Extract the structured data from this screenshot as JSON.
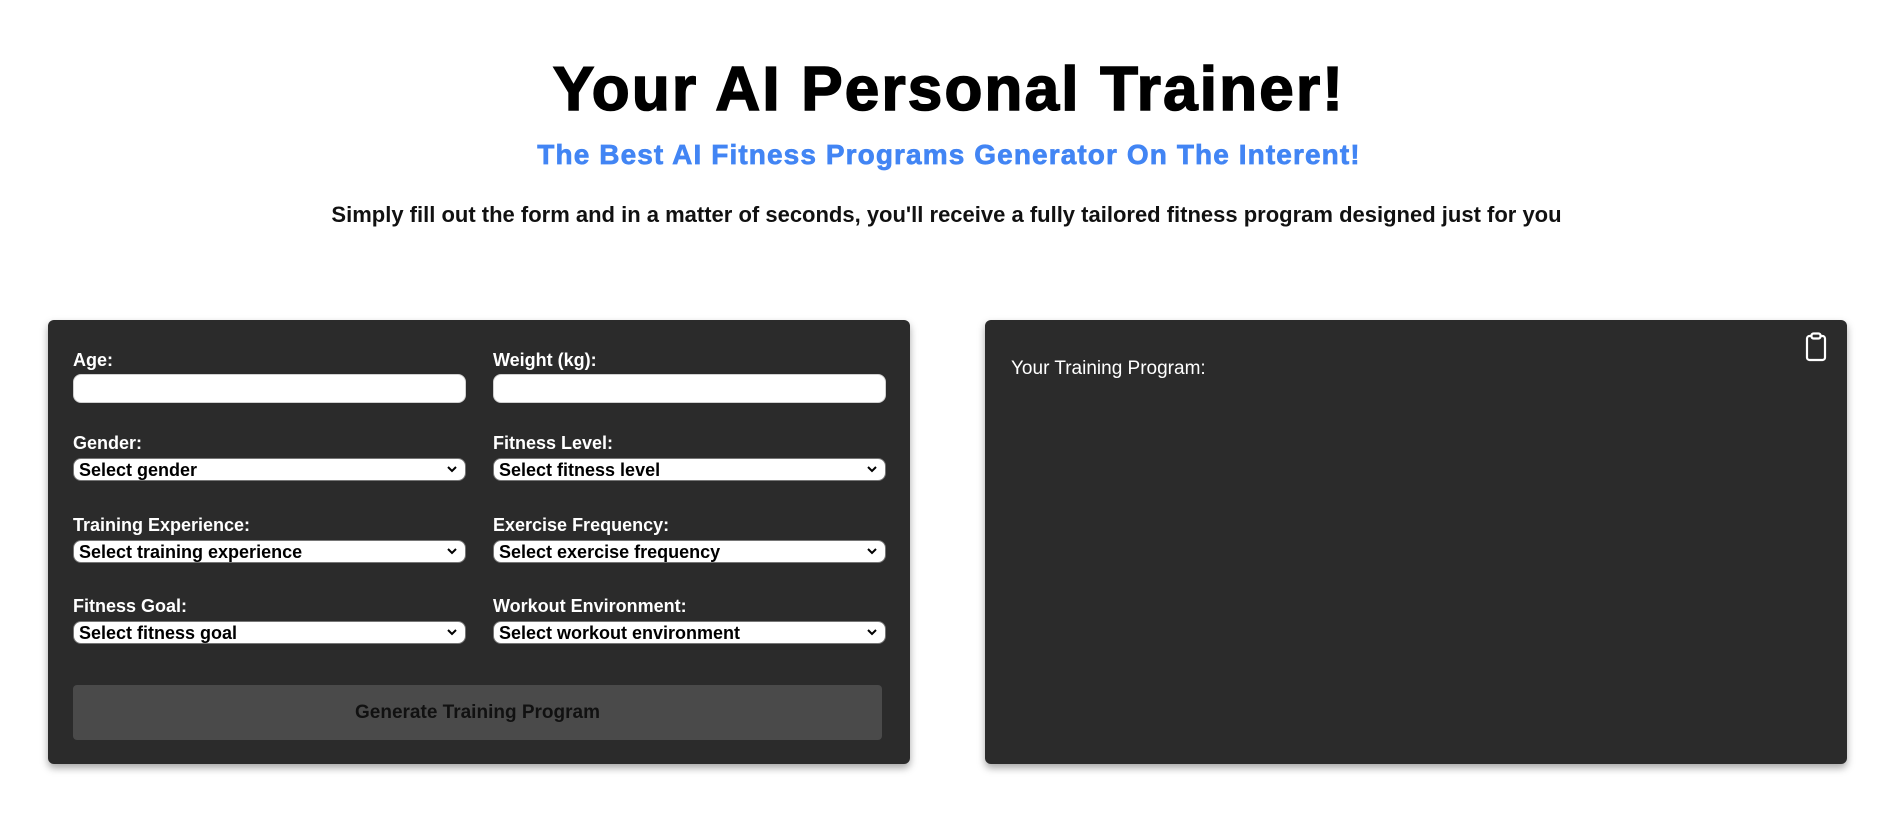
{
  "header": {
    "title": "Your AI Personal Trainer!",
    "subtitle": "The Best AI Fitness Programs Generator On The Interent!",
    "description": "Simply fill out the form and in a matter of seconds, you'll receive a fully tailored fitness program designed just for you"
  },
  "colors": {
    "accent": "#4285f4",
    "panel_bg": "#2b2b2b",
    "button_bg": "#4a4a4a"
  },
  "form": {
    "age": {
      "label": "Age:",
      "value": "",
      "placeholder": ""
    },
    "weight": {
      "label": "Weight (kg):",
      "value": "",
      "placeholder": ""
    },
    "gender": {
      "label": "Gender:",
      "selected": "Select gender"
    },
    "fitness_level": {
      "label": "Fitness Level:",
      "selected": "Select fitness level"
    },
    "training_experience": {
      "label": "Training Experience:",
      "selected": "Select training experience"
    },
    "exercise_frequency": {
      "label": "Exercise Frequency:",
      "selected": "Select exercise frequency"
    },
    "fitness_goal": {
      "label": "Fitness Goal:",
      "selected": "Select fitness goal"
    },
    "workout_environment": {
      "label": "Workout Environment:",
      "selected": "Select workout environment"
    },
    "submit_label": "Generate Training Program"
  },
  "output": {
    "label": "Your Training Program:",
    "content": "",
    "copy_icon": "clipboard-icon"
  }
}
